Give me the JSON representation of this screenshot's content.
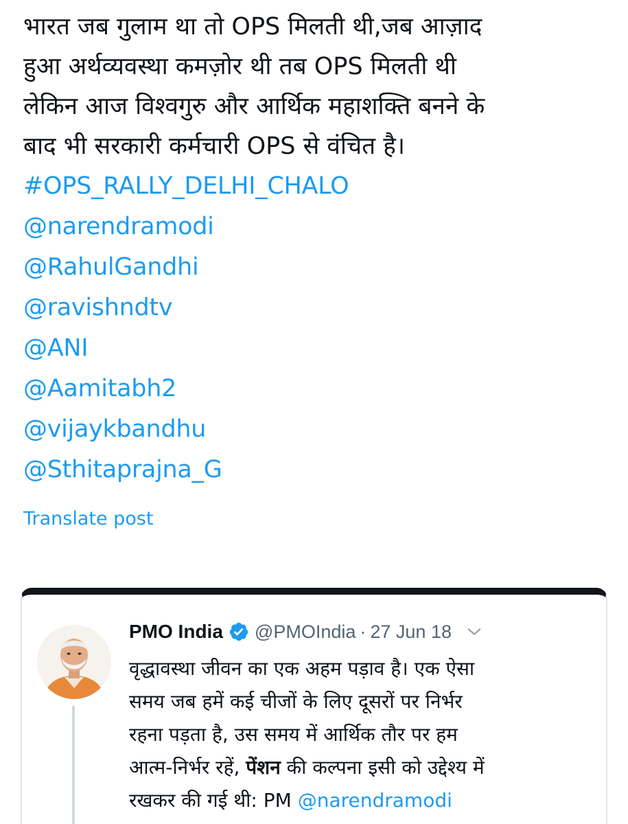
{
  "post": {
    "body": "भारत जब गुलाम था तो OPS मिलती थी,जब आज़ाद\nहुआ अर्थव्यवस्था कमज़ोर थी तब OPS मिलती थी\nलेकिन आज विश्वगुरु और आर्थिक महाशक्ति बनने के\nबाद भी सरकारी कर्मचारी OPS से वंचित है।",
    "hashtag": "#OPS_RALLY_DELHI_CHALO",
    "mentions": [
      "@narendramodi",
      "@RahulGandhi",
      "@ravishndtv",
      "@ANI",
      "@Aamitabh2",
      "@vijaykbandhu",
      "@Sthitaprajna_G"
    ],
    "translate_label": "Translate post"
  },
  "quoted_tweet": {
    "name": "PMO India",
    "verified_icon": "verified-badge-icon",
    "handle": "@PMOIndia",
    "separator": "·",
    "date": "27 Jun 18",
    "more_icon": "chevron-down-icon",
    "text_part1": "वृद्धावस्था जीवन का एक अहम पड़ाव है। एक ऐसा\nसमय जब हमें कई चीजों के लिए दूसरों पर निर्भर\nरहना पड़ता है, उस समय में आर्थिक तौर पर हम\nआत्म-निर्भर रहें, ",
    "text_bold": "पेंशन",
    "text_part2": " की कल्पना इसी को उद्देश्य में\nरखकर की गई थी: PM ",
    "text_link": "@narendramodi"
  },
  "colors": {
    "link": "#1d9bf0",
    "text": "#0f1419",
    "secondary": "#536471",
    "verified": "#1d9bf0"
  }
}
